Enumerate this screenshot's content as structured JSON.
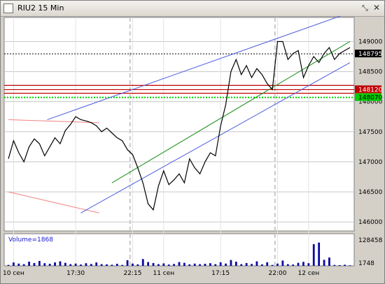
{
  "window": {
    "title": "RIU2 15 Min",
    "maximize_icon": "resize-arrows-icon",
    "close_icon": "close-x-icon"
  },
  "colors": {
    "price_line": "#000000",
    "channel": "#4a5be0",
    "trend": "#1a8f1a",
    "red_level": "#c00000",
    "green_level": "#00cc00",
    "pink_line": "#f08080",
    "volume": "#0a0aa0",
    "grid": "#c8c8c8",
    "session": "#c8c8c8"
  },
  "price_labels": [
    {
      "text": "148795",
      "value": 148795,
      "bg": "#000000",
      "fg": "#ffffff"
    },
    {
      "text": "148120",
      "value": 148200,
      "bg": "#c00000",
      "fg": "#ffffff"
    },
    {
      "text": "148070",
      "value": 148070,
      "bg": "#00cc00",
      "fg": "#000000"
    }
  ],
  "chart_data": {
    "type": "line",
    "title": "RIU2 15 Min",
    "price_axis": {
      "ticks": [
        "149000",
        "148500",
        "148000",
        "147500",
        "147000",
        "146500",
        "146000"
      ],
      "tick_values": [
        149000,
        148500,
        148000,
        147500,
        147000,
        146500,
        146000
      ],
      "ylim": [
        145850,
        149400
      ]
    },
    "x_axis": {
      "labels": [
        "10 сен",
        "17:30",
        "22:15",
        "11 сен",
        "17:15",
        "22:00",
        "12 сен"
      ],
      "label_positions": [
        1,
        13,
        24,
        30,
        41,
        52,
        58
      ],
      "session_breaks": [
        23.5,
        51.5
      ],
      "range": [
        0,
        66
      ]
    },
    "series": [
      {
        "name": "RIU2",
        "x": [
          0,
          1,
          2,
          3,
          4,
          5,
          6,
          7,
          8,
          9,
          10,
          11,
          12,
          13,
          14,
          15,
          16,
          17,
          18,
          19,
          20,
          21,
          22,
          23,
          24,
          25,
          26,
          27,
          28,
          29,
          30,
          31,
          32,
          33,
          34,
          35,
          36,
          37,
          38,
          39,
          40,
          41,
          42,
          43,
          44,
          45,
          46,
          47,
          48,
          49,
          50,
          51,
          52,
          53,
          54,
          55,
          56,
          57,
          58,
          59,
          60,
          61,
          62,
          63,
          64,
          65,
          66
        ],
        "values": [
          147050,
          147350,
          147150,
          147000,
          147250,
          147380,
          147300,
          147100,
          147250,
          147400,
          147300,
          147520,
          147620,
          147750,
          147700,
          147680,
          147650,
          147600,
          147500,
          147560,
          147480,
          147400,
          147350,
          147200,
          147120,
          146900,
          146650,
          146300,
          146200,
          146600,
          146850,
          146620,
          146700,
          146800,
          146650,
          147050,
          146900,
          146800,
          147000,
          147150,
          147100,
          147600,
          147950,
          148500,
          148700,
          148450,
          148600,
          148400,
          148550,
          148450,
          148300,
          148200,
          149000,
          149000,
          148700,
          148800,
          148850,
          148400,
          148600,
          148750,
          148650,
          148800,
          148900,
          148700,
          148800,
          148850,
          148900
        ]
      }
    ],
    "volume": {
      "label": "Volume=1868",
      "ticks": [
        "128458",
        "1748"
      ],
      "tick_values": [
        128458,
        1748
      ],
      "ylim": [
        0,
        155000
      ],
      "bars": [
        5000,
        18000,
        12000,
        9000,
        22000,
        15000,
        26000,
        14000,
        11000,
        18000,
        24000,
        16000,
        9000,
        12000,
        7000,
        14000,
        10000,
        18000,
        9000,
        8000,
        6000,
        11000,
        5000,
        30000,
        12000,
        8000,
        36000,
        20000,
        15000,
        9000,
        13000,
        7000,
        10000,
        20000,
        16000,
        8000,
        12000,
        9000,
        11000,
        14000,
        9000,
        19000,
        12000,
        31000,
        22000,
        9000,
        15000,
        10000,
        13000,
        8000,
        6000,
        5000,
        12000,
        10000,
        9000,
        7000,
        16000,
        8000,
        14000,
        11000,
        7000,
        10000,
        9000,
        5000,
        4000,
        6000,
        3000
      ],
      "spikes": {
        "59": 115000,
        "60": 123000,
        "61": 32000,
        "62": 44000,
        "57": 21000,
        "53": 28000,
        "48": 24000,
        "50": 19000
      }
    }
  }
}
